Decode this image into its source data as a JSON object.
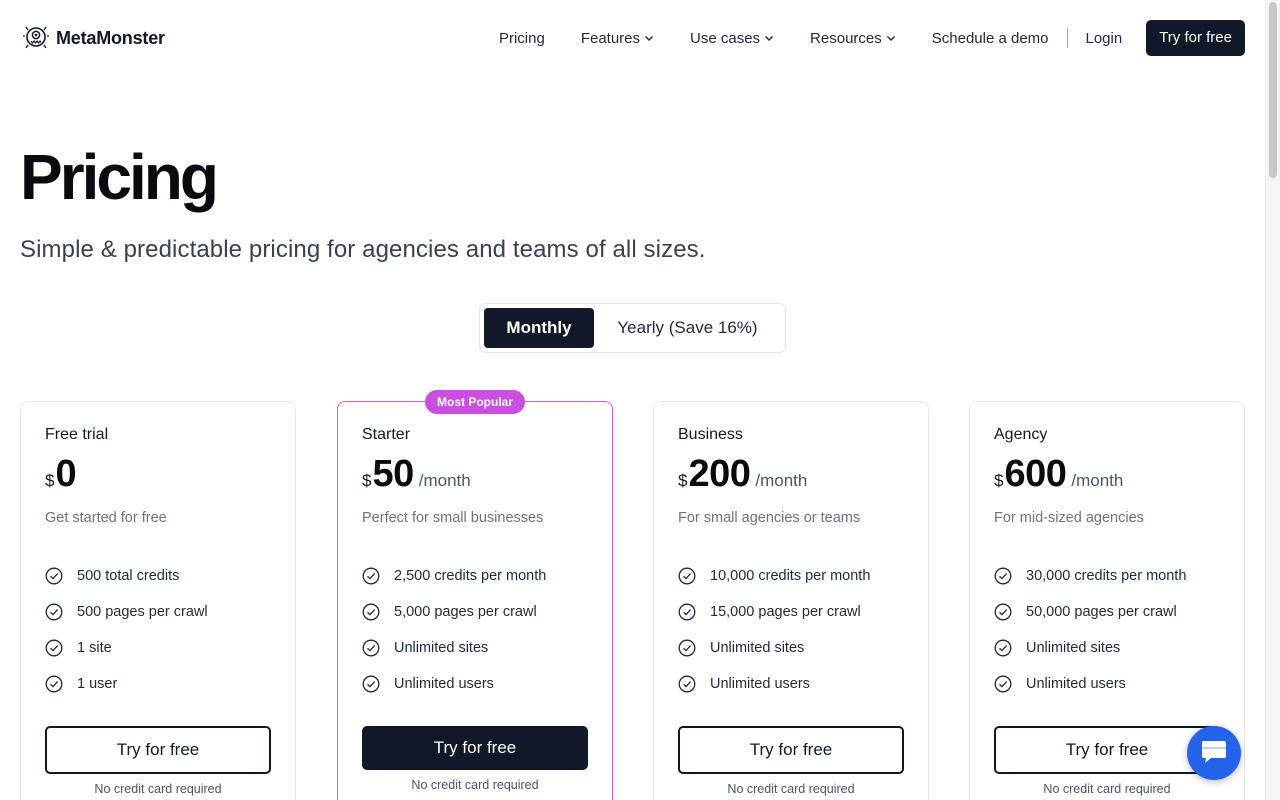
{
  "brand": {
    "name": "MetaMonster",
    "logo_icon": "monster-logo-icon"
  },
  "nav": {
    "items": [
      {
        "label": "Pricing",
        "dropdown": false
      },
      {
        "label": "Features",
        "dropdown": true
      },
      {
        "label": "Use cases",
        "dropdown": true
      },
      {
        "label": "Resources",
        "dropdown": true
      },
      {
        "label": "Schedule a demo",
        "dropdown": false
      }
    ],
    "login": "Login",
    "cta": "Try for free"
  },
  "hero": {
    "title": "Pricing",
    "subtitle": "Simple & predictable pricing for agencies and teams of all sizes."
  },
  "billing_toggle": {
    "monthly": "Monthly",
    "yearly": "Yearly (Save 16%)",
    "selected": "Monthly"
  },
  "plans": [
    {
      "name": "Free trial",
      "currency": "$",
      "amount": "0",
      "period": "",
      "description": "Get started for free",
      "features": [
        "500 total credits",
        "500 pages per crawl",
        "1 site",
        "1 user"
      ],
      "cta": "Try for free",
      "note": "No credit card required",
      "badge": ""
    },
    {
      "name": "Starter",
      "currency": "$",
      "amount": "50",
      "period": "/month",
      "description": "Perfect for small businesses",
      "features": [
        "2,500 credits per month",
        "5,000 pages per crawl",
        "Unlimited sites",
        "Unlimited users"
      ],
      "cta": "Try for free",
      "note": "No credit card required",
      "badge": "Most Popular"
    },
    {
      "name": "Business",
      "currency": "$",
      "amount": "200",
      "period": "/month",
      "description": "For small agencies or teams",
      "features": [
        "10,000 credits per month",
        "15,000 pages per crawl",
        "Unlimited sites",
        "Unlimited users"
      ],
      "cta": "Try for free",
      "note": "No credit card required",
      "badge": ""
    },
    {
      "name": "Agency",
      "currency": "$",
      "amount": "600",
      "period": "/month",
      "description": "For mid-sized agencies",
      "features": [
        "30,000 credits per month",
        "50,000 pages per crawl",
        "Unlimited sites",
        "Unlimited users"
      ],
      "cta": "Try for free",
      "note": "No credit card required",
      "badge": ""
    }
  ],
  "colors": {
    "primary_dark": "#111827",
    "badge": "#c94fe0",
    "popular_border": "#d45ad9",
    "chat": "#2563eb"
  },
  "icons": {
    "feature": "check-circle-icon",
    "dropdown": "chevron-down-icon",
    "chat": "chat-bubble-icon"
  }
}
